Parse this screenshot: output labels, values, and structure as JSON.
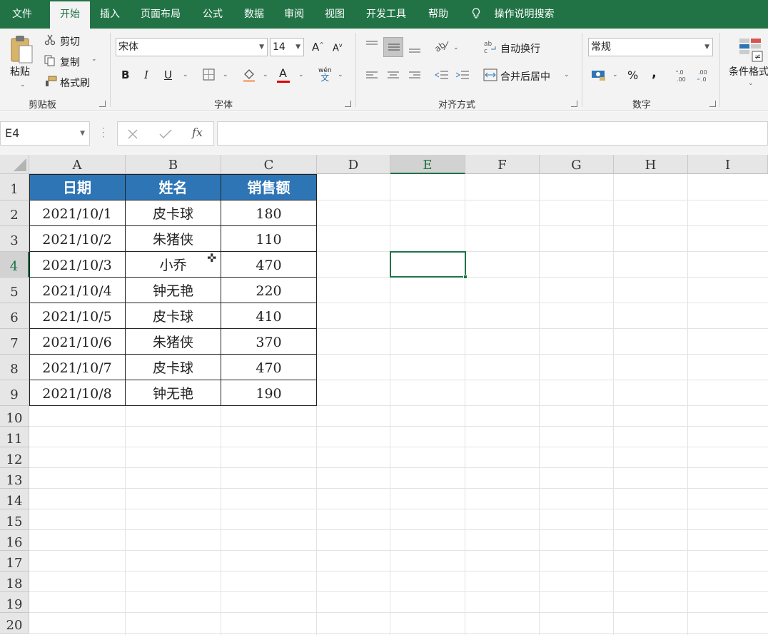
{
  "ribbon_tabs": [
    {
      "label": "文件",
      "active": false
    },
    {
      "label": "开始",
      "active": true
    },
    {
      "label": "插入",
      "active": false
    },
    {
      "label": "页面布局",
      "active": false
    },
    {
      "label": "公式",
      "active": false
    },
    {
      "label": "数据",
      "active": false
    },
    {
      "label": "审阅",
      "active": false
    },
    {
      "label": "视图",
      "active": false
    },
    {
      "label": "开发工具",
      "active": false
    },
    {
      "label": "帮助",
      "active": false
    }
  ],
  "tell_me": "操作说明搜索",
  "clipboard": {
    "paste": "粘贴",
    "cut": "剪切",
    "copy": "复制",
    "format_painter": "格式刷",
    "group_label": "剪贴板"
  },
  "font": {
    "name": "宋体",
    "size": "14",
    "bold": "B",
    "italic": "I",
    "underline": "U",
    "grow": "A",
    "shrink": "A",
    "font_color_letter": "A",
    "phonetic_top": "wén",
    "phonetic_bottom": "文",
    "group_label": "字体"
  },
  "alignment": {
    "wrap_text": "自动换行",
    "merge_center": "合并后居中",
    "group_label": "对齐方式"
  },
  "number": {
    "format": "常规",
    "percent": "%",
    "comma": ",",
    "group_label": "数字"
  },
  "styles": {
    "conditional_format": "条件格式"
  },
  "formula_bar": {
    "name_box": "E4",
    "fx": "fx",
    "formula": ""
  },
  "columns": [
    "A",
    "B",
    "C",
    "D",
    "E",
    "F",
    "G",
    "H",
    "I"
  ],
  "selected_column": "E",
  "rows": [
    "1",
    "2",
    "3",
    "4",
    "5",
    "6",
    "7",
    "8",
    "9",
    "10",
    "11",
    "12",
    "13",
    "14",
    "15",
    "16",
    "17",
    "18",
    "19",
    "20"
  ],
  "selected_row": "4",
  "table": {
    "headers": [
      "日期",
      "姓名",
      "销售额"
    ],
    "rows": [
      [
        "2021/10/1",
        "皮卡球",
        "180"
      ],
      [
        "2021/10/2",
        "朱猪侠",
        "110"
      ],
      [
        "2021/10/3",
        "小乔",
        "470"
      ],
      [
        "2021/10/4",
        "钟无艳",
        "220"
      ],
      [
        "2021/10/5",
        "皮卡球",
        "410"
      ],
      [
        "2021/10/6",
        "朱猪侠",
        "370"
      ],
      [
        "2021/10/7",
        "皮卡球",
        "470"
      ],
      [
        "2021/10/8",
        "钟无艳",
        "190"
      ]
    ],
    "header_color": "#2e75b6"
  },
  "colors": {
    "brand": "#217346"
  }
}
